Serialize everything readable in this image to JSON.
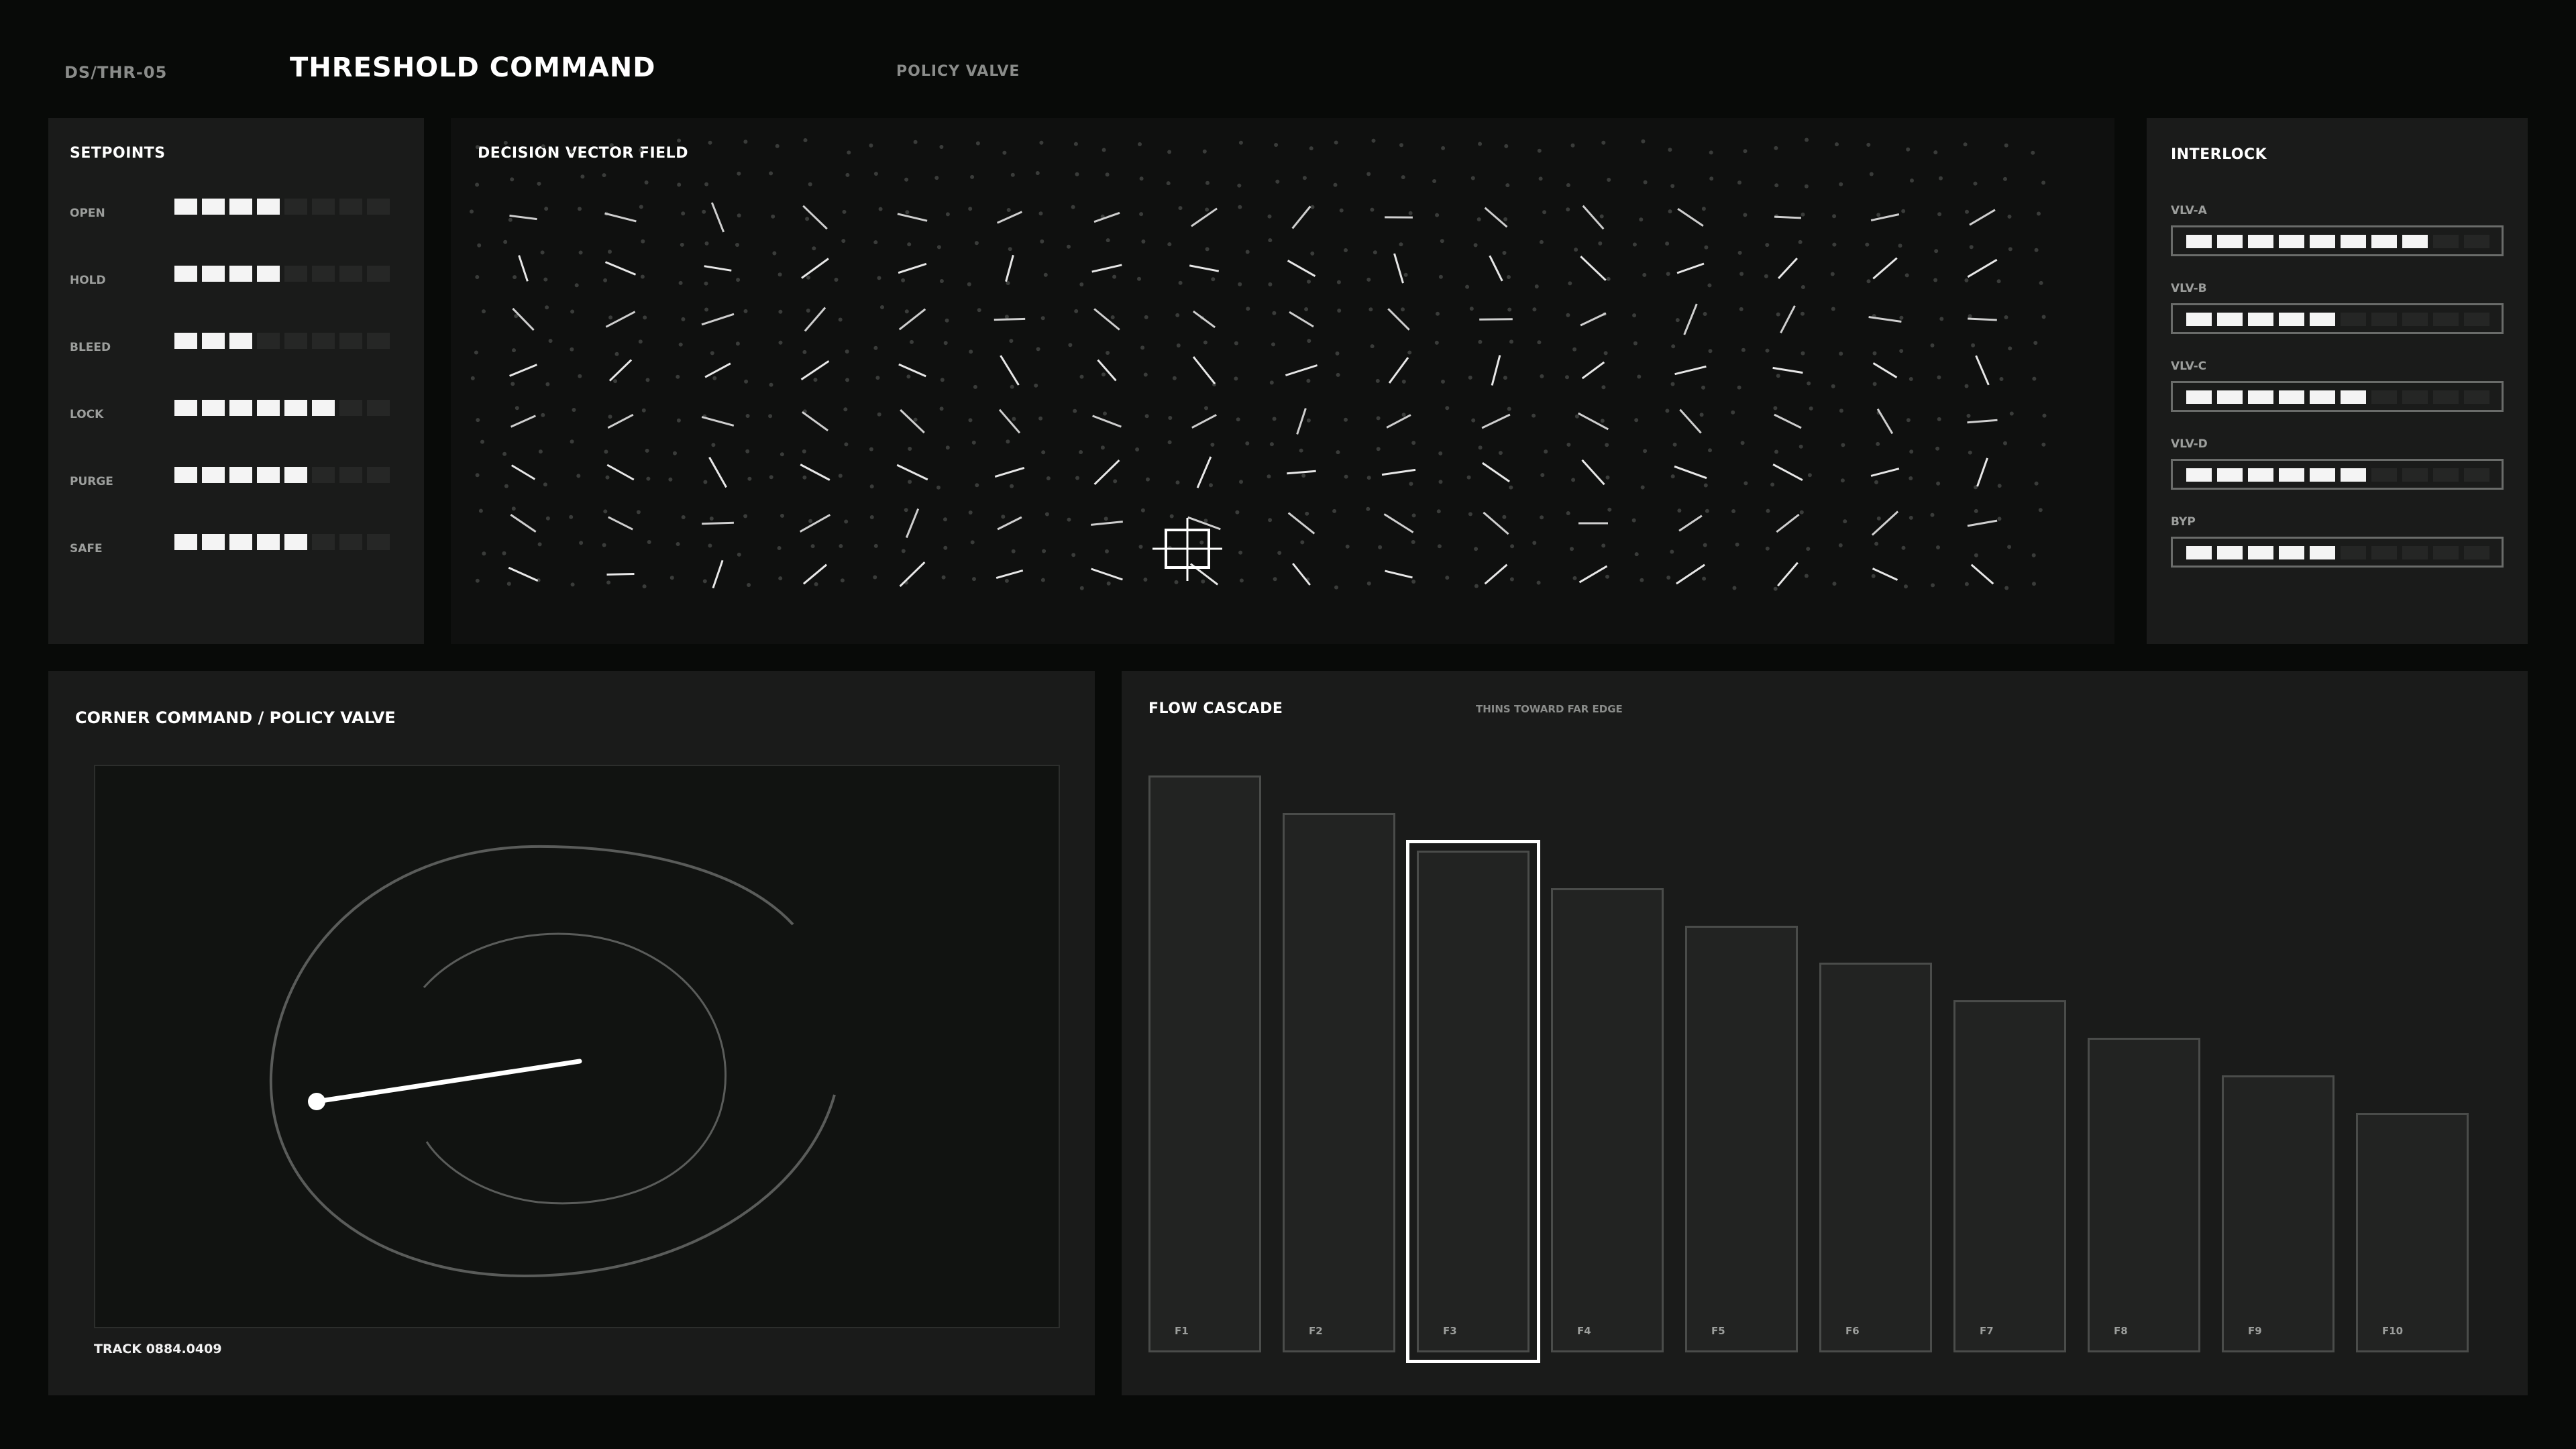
{
  "header": {
    "id": "DS/THR-05",
    "title": "THRESHOLD COMMAND",
    "subtitle": "POLICY VALVE"
  },
  "setpoints": {
    "title": "SETPOINTS",
    "total_blocks": 8,
    "items": [
      {
        "label": "OPEN",
        "level": 4
      },
      {
        "label": "HOLD",
        "level": 4
      },
      {
        "label": "BLEED",
        "level": 3
      },
      {
        "label": "LOCK",
        "level": 6
      },
      {
        "label": "PURGE",
        "level": 5
      },
      {
        "label": "SAFE",
        "level": 5
      }
    ]
  },
  "vector_field": {
    "title": "DECISION VECTOR FIELD"
  },
  "interlock": {
    "title": "INTERLOCK",
    "total_blocks": 10,
    "items": [
      {
        "label": "VLV-A",
        "level": 8
      },
      {
        "label": "VLV-B",
        "level": 5
      },
      {
        "label": "VLV-C",
        "level": 6
      },
      {
        "label": "VLV-D",
        "level": 6
      },
      {
        "label": "BYP",
        "level": 5
      }
    ]
  },
  "corner": {
    "title": "CORNER COMMAND  /  POLICY VALVE",
    "track": "TRACK 0884.0409"
  },
  "cascade": {
    "title": "FLOW CASCADE",
    "note": "THINS TOWARD FAR EDGE",
    "selected": "F3",
    "bars": [
      {
        "label": "F1",
        "value": 1.0
      },
      {
        "label": "F2",
        "value": 0.935
      },
      {
        "label": "F3",
        "value": 0.87
      },
      {
        "label": "F4",
        "value": 0.805
      },
      {
        "label": "F5",
        "value": 0.74
      },
      {
        "label": "F6",
        "value": 0.675
      },
      {
        "label": "F7",
        "value": 0.61
      },
      {
        "label": "F8",
        "value": 0.545
      },
      {
        "label": "F9",
        "value": 0.48
      },
      {
        "label": "F10",
        "value": 0.415
      }
    ]
  },
  "colors": {
    "background": "#080a08",
    "panel": "#1a1b1a",
    "block_on": "#f4f4f4",
    "block_off": "#262726",
    "accent": "#ffffff"
  }
}
